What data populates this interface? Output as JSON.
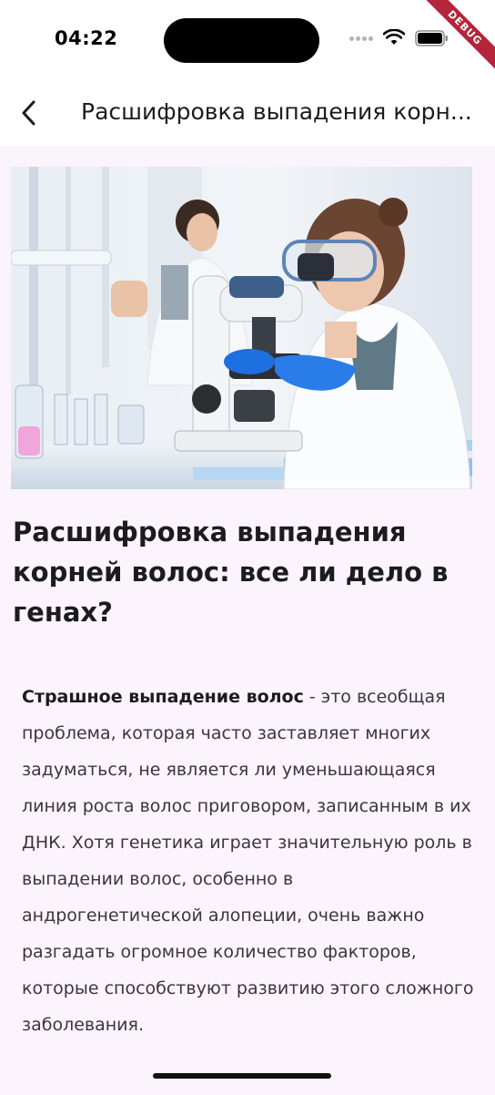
{
  "status_bar": {
    "time": "04:22",
    "debug_label": "DEBUG"
  },
  "app_bar": {
    "title": "Расшифровка выпадения корн..."
  },
  "hero": {
    "icon": "lab-photo"
  },
  "article": {
    "title": "Расшифровка выпадения корней волос: все ли дело в генах?",
    "lead_bold": "Страшное выпадение волос",
    "lead_rest": " - это всеобщая проблема, которая часто заставляет многих задуматься, не является ли уменьшающаяся линия роста волос приговором, записанным в их ДНК. Хотя генетика играет значительную роль в выпадении волос, особенно в андрогенетической алопеции, очень важно разгадать огромное количество факторов, которые способствуют развитию этого сложного заболевания."
  },
  "colors": {
    "background": "#fcf4fc",
    "debug_ribbon": "#b4243a",
    "glove_blue": "#1e6fe0"
  }
}
